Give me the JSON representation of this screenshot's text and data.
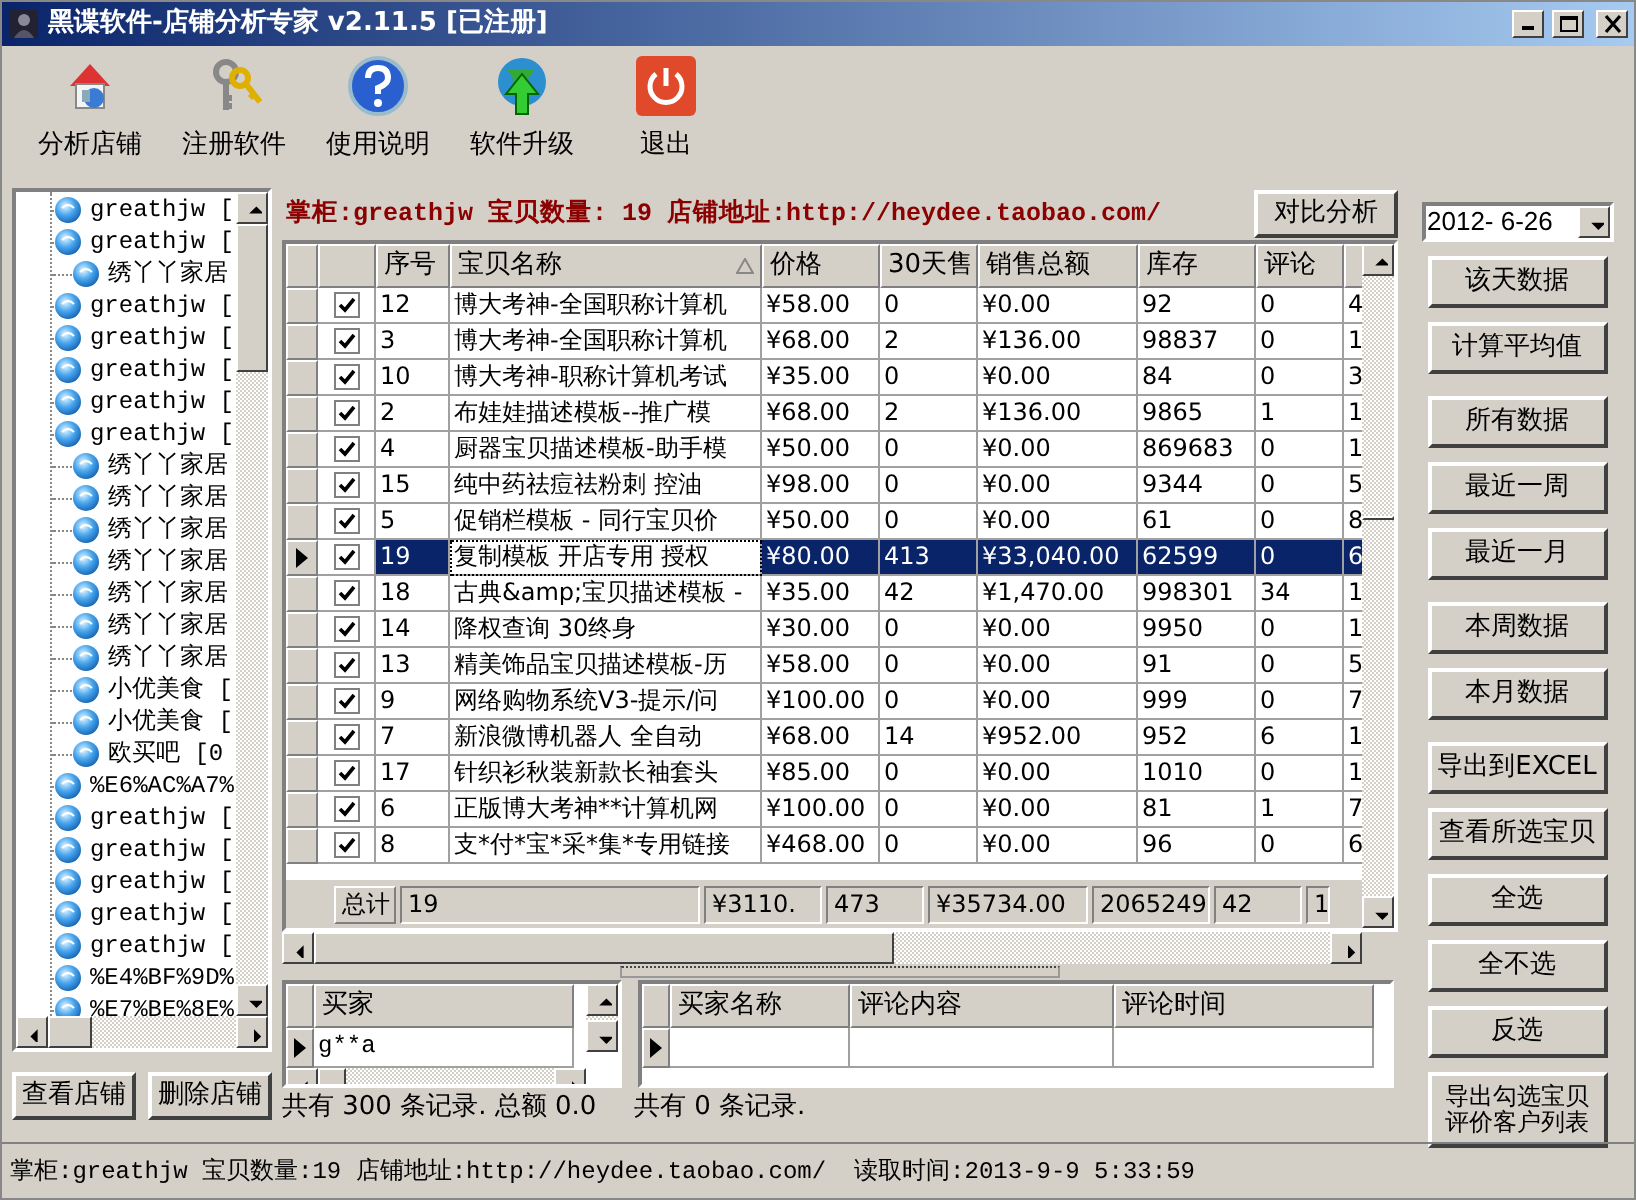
{
  "window": {
    "title": "黑谍软件-店铺分析专家 v2.11.5 [已注册]"
  },
  "toolbar": [
    {
      "label": "分析店铺",
      "kind": "house"
    },
    {
      "label": "注册软件",
      "kind": "keys"
    },
    {
      "label": "使用说明",
      "kind": "help"
    },
    {
      "label": "软件升级",
      "kind": "upgrade"
    },
    {
      "label": "退出",
      "kind": "power"
    }
  ],
  "shop_tree": {
    "items": [
      {
        "label": "greathjw ["
      },
      {
        "label": "greathjw ["
      },
      {
        "label": "绣丫丫家居"
      },
      {
        "label": "greathjw ["
      },
      {
        "label": "greathjw ["
      },
      {
        "label": "greathjw ["
      },
      {
        "label": "greathjw ["
      },
      {
        "label": "greathjw ["
      },
      {
        "label": "绣丫丫家居"
      },
      {
        "label": "绣丫丫家居"
      },
      {
        "label": "绣丫丫家居"
      },
      {
        "label": "绣丫丫家居"
      },
      {
        "label": "绣丫丫家居"
      },
      {
        "label": "绣丫丫家居"
      },
      {
        "label": "绣丫丫家居"
      },
      {
        "label": "小优美食 ["
      },
      {
        "label": "小优美食 ["
      },
      {
        "label": "欧买吧 [0"
      },
      {
        "label": "%E6%AC%A7%"
      },
      {
        "label": "greathjw ["
      },
      {
        "label": "greathjw ["
      },
      {
        "label": "greathjw ["
      },
      {
        "label": "greathjw ["
      },
      {
        "label": "greathjw ["
      },
      {
        "label": "%E4%BF%9D%"
      },
      {
        "label": "%E7%BE%8E%"
      }
    ],
    "buttons": [
      "查看店铺",
      "删除店铺"
    ]
  },
  "shop_header": {
    "text": "掌柜:greathjw 宝贝数量: 19 店铺地址:http://heydee.taobao.com/",
    "button": "对比分析"
  },
  "items_table": {
    "columns": [
      "序号",
      "宝贝名称",
      "价格",
      "30天售",
      "销售总额",
      "库存",
      "评论"
    ],
    "rows": [
      {
        "checked": true,
        "selected": false,
        "cells": [
          "12",
          "博大考神-全国职称计算机",
          "¥58.00",
          "0",
          "¥0.00",
          "92",
          "0",
          "4"
        ]
      },
      {
        "checked": true,
        "selected": false,
        "cells": [
          "3",
          "博大考神-全国职称计算机",
          "¥68.00",
          "2",
          "¥136.00",
          "98837",
          "0",
          "1"
        ]
      },
      {
        "checked": true,
        "selected": false,
        "cells": [
          "10",
          "博大考神-职称计算机考试",
          "¥35.00",
          "0",
          "¥0.00",
          "84",
          "0",
          "3"
        ]
      },
      {
        "checked": true,
        "selected": false,
        "cells": [
          "2",
          "布娃娃描述模板--推广模",
          "¥68.00",
          "2",
          "¥136.00",
          "9865",
          "1",
          "1"
        ]
      },
      {
        "checked": true,
        "selected": false,
        "cells": [
          "4",
          "厨器宝贝描述模板-助手模",
          "¥50.00",
          "0",
          "¥0.00",
          "869683",
          "0",
          "1"
        ]
      },
      {
        "checked": true,
        "selected": false,
        "cells": [
          "15",
          "纯中药祛痘祛粉刺 控油",
          "¥98.00",
          "0",
          "¥0.00",
          "9344",
          "0",
          "5"
        ]
      },
      {
        "checked": true,
        "selected": false,
        "cells": [
          "5",
          "促销栏模板 - 同行宝贝价",
          "¥50.00",
          "0",
          "¥0.00",
          "61",
          "0",
          "8"
        ]
      },
      {
        "checked": true,
        "selected": true,
        "cells": [
          "19",
          "复制模板 开店专用 授权",
          "¥80.00",
          "413",
          "¥33,040.00",
          "62599",
          "0",
          "6"
        ]
      },
      {
        "checked": true,
        "selected": false,
        "cells": [
          "18",
          "古典&amp;宝贝描述模板 -",
          "¥35.00",
          "42",
          "¥1,470.00",
          "998301",
          "34",
          "1"
        ]
      },
      {
        "checked": true,
        "selected": false,
        "cells": [
          "14",
          "降权查询 30终身",
          "¥30.00",
          "0",
          "¥0.00",
          "9950",
          "0",
          "1"
        ]
      },
      {
        "checked": true,
        "selected": false,
        "cells": [
          "13",
          "精美饰品宝贝描述模板-历",
          "¥58.00",
          "0",
          "¥0.00",
          "91",
          "0",
          "5"
        ]
      },
      {
        "checked": true,
        "selected": false,
        "cells": [
          "9",
          "网络购物系统V3-提示/问",
          "¥100.00",
          "0",
          "¥0.00",
          "999",
          "0",
          "7"
        ]
      },
      {
        "checked": true,
        "selected": false,
        "cells": [
          "7",
          "新浪微博机器人 全自动",
          "¥68.00",
          "14",
          "¥952.00",
          "952",
          "6",
          "1"
        ]
      },
      {
        "checked": true,
        "selected": false,
        "cells": [
          "17",
          "针织衫秋装新款长袖套头",
          "¥85.00",
          "0",
          "¥0.00",
          "1010",
          "0",
          "1"
        ]
      },
      {
        "checked": true,
        "selected": false,
        "cells": [
          "6",
          "正版博大考神**计算机网",
          "¥100.00",
          "0",
          "¥0.00",
          "81",
          "1",
          "7"
        ]
      },
      {
        "checked": true,
        "selected": false,
        "cells": [
          "8",
          "支*付*宝*采*集*专用链接",
          "¥468.00",
          "0",
          "¥0.00",
          "96",
          "0",
          "6"
        ]
      }
    ],
    "totals": [
      "总计",
      "19",
      "¥3110.",
      "473",
      "¥35734.00",
      "2065249",
      "42",
      "1"
    ]
  },
  "buyers_table": {
    "columns": [
      "买家"
    ],
    "rows": [
      {
        "selected": true,
        "cells": [
          "g**a"
        ]
      }
    ],
    "summary": "共有 300 条记录. 总额 0.0"
  },
  "comments_table": {
    "columns": [
      "买家名称",
      "评论内容",
      "评论时间"
    ],
    "rows": [
      {
        "selected": true
      }
    ],
    "summary": "共有 0 条记录."
  },
  "date_picker": {
    "value": "2012- 6-26"
  },
  "button_groups": [
    [
      "该天数据",
      "计算平均值"
    ],
    [
      "所有数据",
      "最近一周",
      "最近一月"
    ],
    [
      "本周数据",
      "本月数据"
    ],
    [
      "导出到EXCEL",
      "查看所选宝贝",
      "全选",
      "全不选",
      "反选",
      "导出勾选宝贝评价客户列表"
    ]
  ],
  "status_bar": {
    "shop": "掌柜:greathjw 宝贝数量:19 店铺地址:http://heydee.taobao.com/",
    "read_time": "读取时间:2013-9-9 5:33:59"
  }
}
